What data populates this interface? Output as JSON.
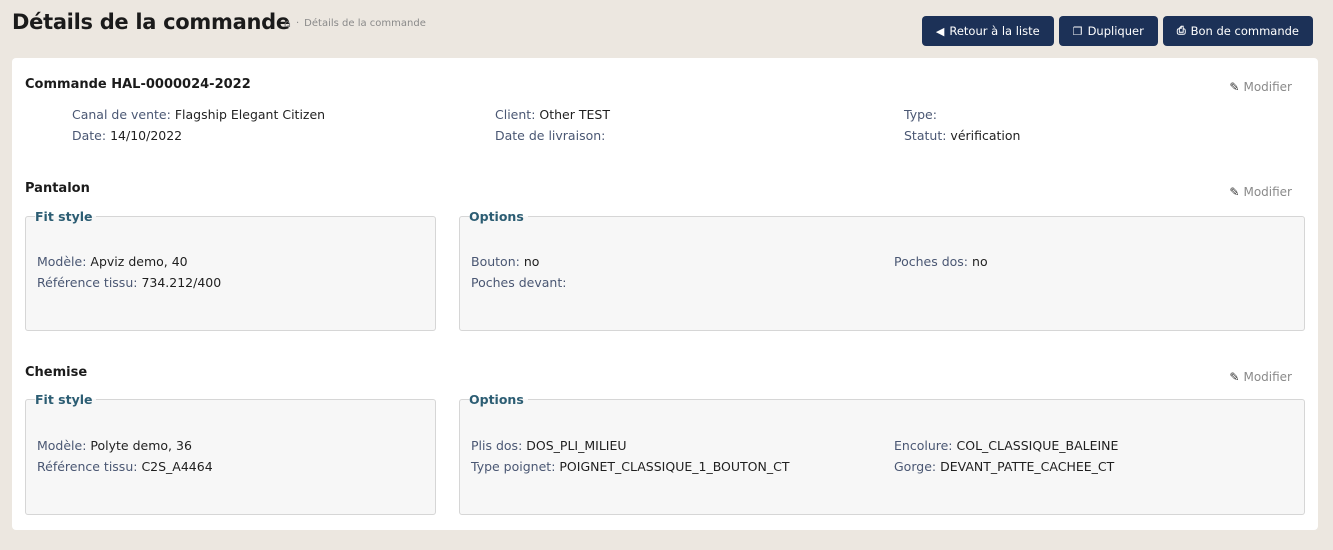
{
  "header": {
    "title": "Détails de la commande",
    "breadcrumb_sep": "·",
    "breadcrumb_current": "Détails de la commande",
    "buttons": {
      "back": "Retour à la liste",
      "duplicate": "Dupliquer",
      "order_form": "Bon de commande"
    }
  },
  "order": {
    "title": "Commande HAL-0000024-2022",
    "modify": "Modifier",
    "fields": {
      "channel_label": "Canal de vente:",
      "channel_value": "Flagship Elegant Citizen",
      "date_label": "Date:",
      "date_value": "14/10/2022",
      "client_label": "Client:",
      "client_value": "Other TEST",
      "delivery_label": "Date de livraison:",
      "delivery_value": "",
      "type_label": "Type:",
      "type_value": "",
      "status_label": "Statut:",
      "status_value": "vérification"
    }
  },
  "pantalon": {
    "title": "Pantalon",
    "modify": "Modifier",
    "fit_legend": "Fit style",
    "options_legend": "Options",
    "model_label": "Modèle:",
    "model_value": "Apviz demo, 40",
    "fabric_label": "Référence tissu:",
    "fabric_value": "734.212/400",
    "bouton_label": "Bouton:",
    "bouton_value": "no",
    "poches_devant_label": "Poches devant:",
    "poches_devant_value": "",
    "poches_dos_label": "Poches dos:",
    "poches_dos_value": "no"
  },
  "chemise": {
    "title": "Chemise",
    "modify": "Modifier",
    "fit_legend": "Fit style",
    "options_legend": "Options",
    "model_label": "Modèle:",
    "model_value": "Polyte demo, 36",
    "fabric_label": "Référence tissu:",
    "fabric_value": "C2S_A4464",
    "plis_label": "Plis dos:",
    "plis_value": "DOS_PLI_MILIEU",
    "poignet_label": "Type poignet:",
    "poignet_value": "POIGNET_CLASSIQUE_1_BOUTON_CT",
    "encolure_label": "Encolure:",
    "encolure_value": "COL_CLASSIQUE_BALEINE",
    "gorge_label": "Gorge:",
    "gorge_value": "DEVANT_PATTE_CACHEE_CT"
  }
}
